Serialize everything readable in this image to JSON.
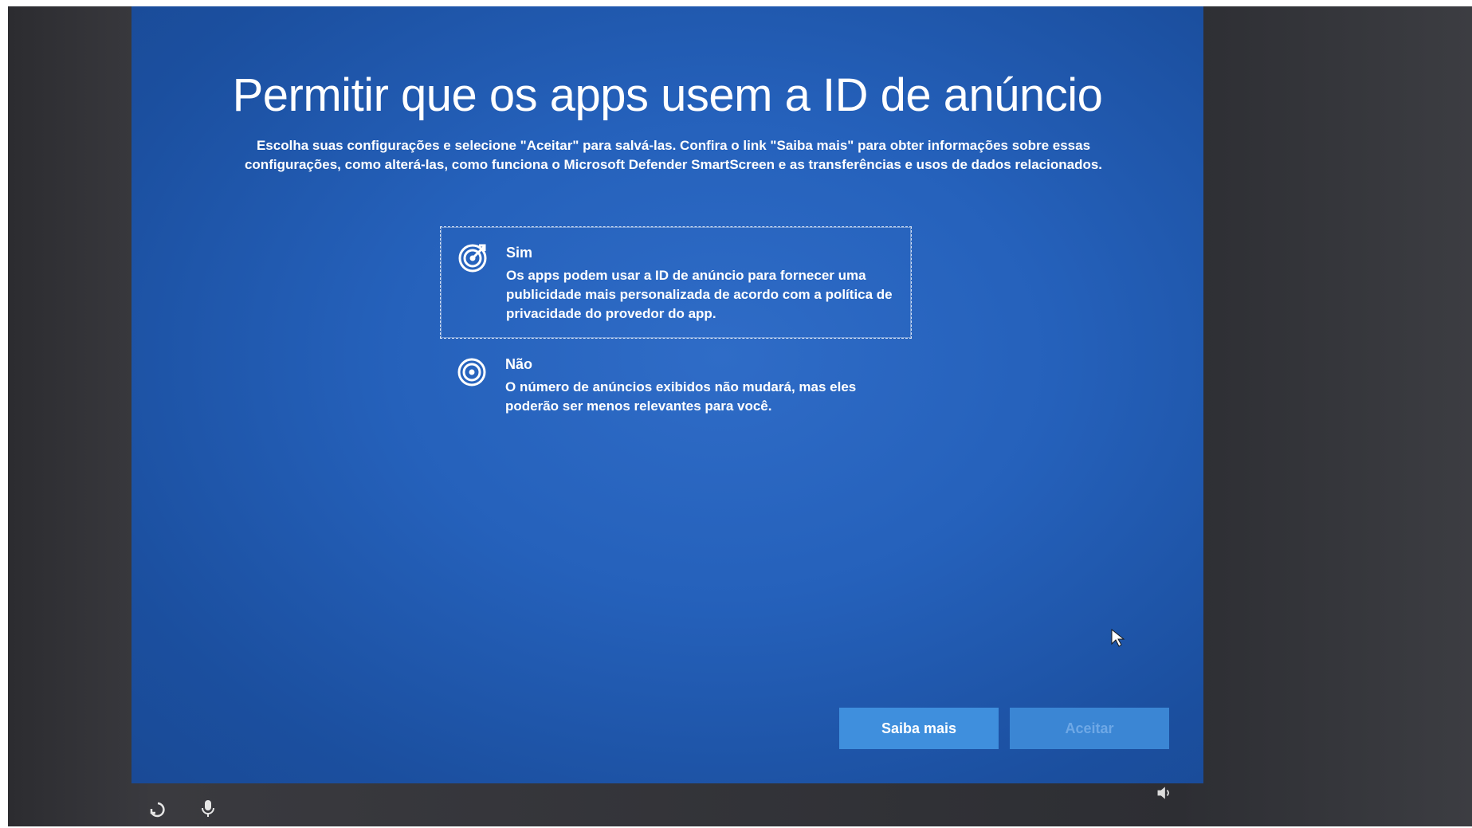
{
  "page": {
    "title": "Permitir que os apps usem a ID de anúncio",
    "subtitle": "Escolha suas configurações e selecione \"Aceitar\" para salvá-las. Confira o link \"Saiba mais\" para obter informações sobre essas configurações, como alterá-las, como funciona o Microsoft Defender SmartScreen e as transferências e usos de dados relacionados."
  },
  "options": [
    {
      "label": "Sim",
      "description": "Os apps podem usar a ID de anúncio para fornecer uma publicidade mais personalizada de acordo com a política de privacidade do provedor do app.",
      "icon": "target-arrow-icon",
      "selected": true
    },
    {
      "label": "Não",
      "description": "O número de anúncios exibidos não mudará, mas eles poderão ser menos relevantes para você.",
      "icon": "target-icon",
      "selected": false
    }
  ],
  "buttons": {
    "learn_more": "Saiba mais",
    "accept": "Aceitar"
  },
  "bottom_icons": [
    "ease-of-access-icon",
    "microphone-icon",
    "volume-icon"
  ],
  "colors": {
    "background": "#2561bb",
    "button": "#3f8fdd",
    "text": "#ffffff"
  }
}
